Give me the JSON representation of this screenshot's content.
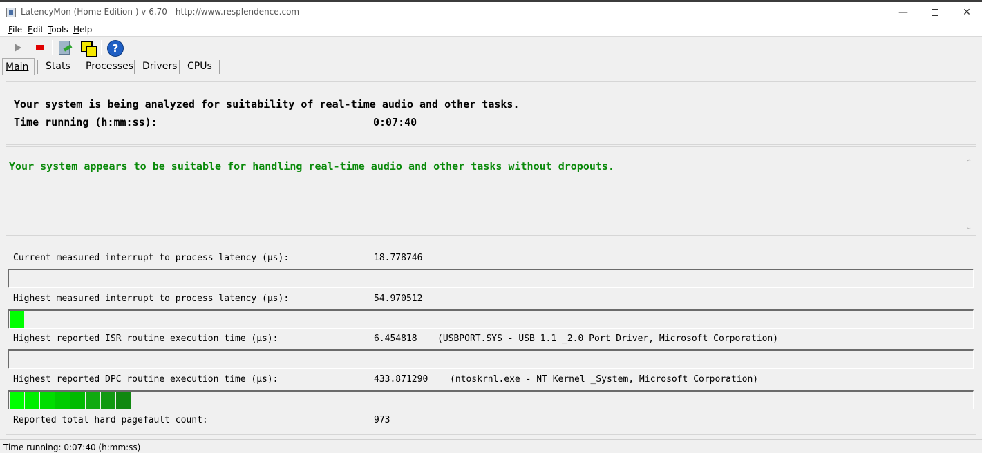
{
  "window": {
    "title": "LatencyMon  (Home Edition )  v 6.70 - http://www.resplendence.com",
    "minimize_glyph": "—",
    "close_glyph": "✕"
  },
  "menu": {
    "items": [
      {
        "label": "File",
        "accel": "F",
        "rest": "ile"
      },
      {
        "label": "Edit",
        "accel": "E",
        "rest": "dit"
      },
      {
        "label": "Tools",
        "accel": "T",
        "rest": "ools"
      },
      {
        "label": "Help",
        "accel": "H",
        "rest": "elp"
      }
    ]
  },
  "toolbar": {
    "icons": [
      "play-icon",
      "stop-icon",
      "settings-tool-icon",
      "window-tool-icon",
      "help-icon"
    ]
  },
  "tabs": [
    {
      "label": "Main",
      "active": true
    },
    {
      "label": "Stats",
      "active": false
    },
    {
      "label": "Processes",
      "active": false
    },
    {
      "label": "Drivers",
      "active": false
    },
    {
      "label": "CPUs",
      "active": false
    }
  ],
  "summary": {
    "analyzing_text": "Your system is being analyzed for suitability of real-time audio and other tasks.",
    "time_label": "Time running (h:mm:ss):",
    "time_value": "0:07:40"
  },
  "verdict": {
    "message": "Your system appears to be suitable for handling real-time audio and other tasks without dropouts.",
    "color": "#0a8a0a"
  },
  "metrics": [
    {
      "label": "Current measured interrupt to process latency (µs):",
      "value": "18.778746",
      "detail": "",
      "bar_segments": 0
    },
    {
      "label": "Highest measured interrupt to process latency (µs):",
      "value": "54.970512",
      "detail": "",
      "bar_segments": 1
    },
    {
      "label": "Highest reported ISR routine execution time (µs):",
      "value": "6.454818",
      "detail": "(USBPORT.SYS - USB 1.1 _2.0 Port Driver, Microsoft Corporation)",
      "bar_segments": 0
    },
    {
      "label": "Highest reported DPC routine execution time (µs):",
      "value": "433.871290",
      "detail": "(ntoskrnl.exe - NT Kernel _System, Microsoft Corporation)",
      "bar_segments": 8
    },
    {
      "label": "Reported total hard pagefault count:",
      "value": "973",
      "detail": ""
    }
  ],
  "bar_colors": [
    "#00ff00",
    "#00ee00",
    "#00dd00",
    "#00cc00",
    "#00bb00",
    "#11aa11",
    "#119911",
    "#118811"
  ],
  "scroll": {
    "up": "⌃",
    "down": "⌄"
  },
  "status": {
    "text": "Time running: 0:07:40  (h:mm:ss)"
  }
}
